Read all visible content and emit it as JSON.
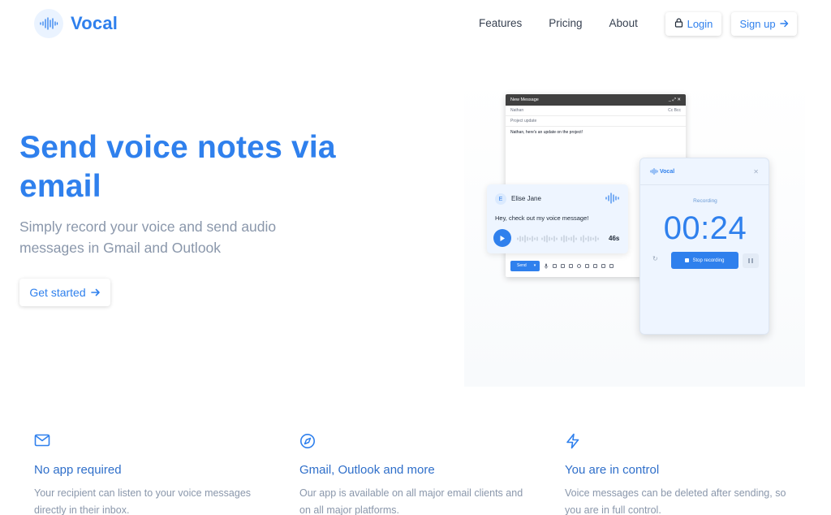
{
  "brand": {
    "name": "Vocal"
  },
  "nav": {
    "links": [
      "Features",
      "Pricing",
      "About"
    ],
    "login_label": "Login",
    "signup_label": "Sign up"
  },
  "hero": {
    "title": "Send voice notes via email",
    "subtitle": "Simply record your voice and send audio messages in Gmail and Outlook",
    "cta_label": "Get started"
  },
  "illustration": {
    "mail": {
      "header_title": "New Message",
      "to": "Nathan",
      "cc_bcc": "Cc Bcc",
      "subject": "Project update",
      "body": "Nathan, here's an update on the project!",
      "send_label": "Send"
    },
    "voice_card": {
      "avatar_initial": "E",
      "sender": "Elise Jane",
      "message": "Hey, check out my voice message!",
      "duration": "46s"
    },
    "recorder": {
      "logo_text": "Vocal",
      "status": "Recording",
      "timer": "00:24",
      "stop_label": "Stop recording"
    }
  },
  "features": [
    {
      "icon": "mail-icon",
      "title": "No app required",
      "text": "Your recipient can listen to your voice messages directly in their inbox."
    },
    {
      "icon": "compass-icon",
      "title": "Gmail, Outlook and more",
      "text": "Our app is available on all major email clients and on all major platforms."
    },
    {
      "icon": "lightning-icon",
      "title": "You are in control",
      "text": "Voice messages can be deleted after sending, so you are in full control."
    }
  ],
  "colors": {
    "accent": "#2f80ed",
    "muted_text": "#8a97ab",
    "card_bg": "#eef5ff"
  }
}
